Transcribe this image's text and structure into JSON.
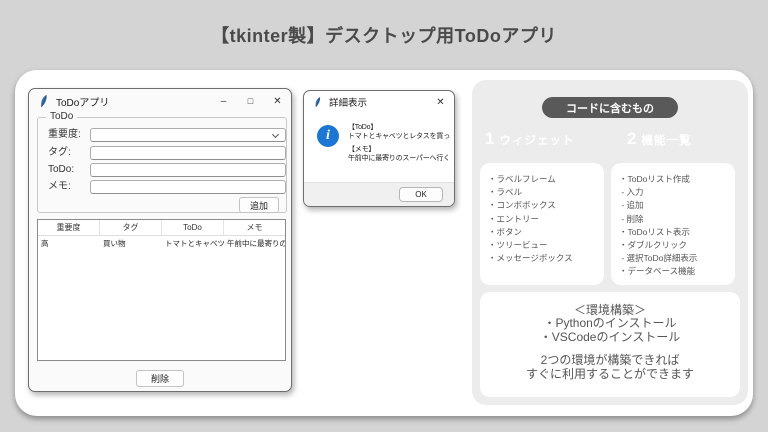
{
  "slide": {
    "title": "【tkinter製】デスクトップ用ToDoアプリ"
  },
  "todo_window": {
    "title": "ToDoアプリ",
    "controls": {
      "minimize": "–",
      "maximize": "□",
      "close": "✕"
    },
    "form": {
      "frame_label": "ToDo",
      "importance_label": "重要度:",
      "tag_label": "タグ:",
      "todo_label": "ToDo:",
      "memo_label": "メモ:",
      "importance_value": "",
      "add_button": "追加"
    },
    "tree": {
      "columns": [
        "重要度",
        "タグ",
        "ToDo",
        "メモ"
      ],
      "row": [
        "高",
        "買い物",
        "トマトとキャベツとレタスを買ってくる",
        "午前中に最寄りのスーパーへ行くこと"
      ]
    },
    "delete_button": "削除"
  },
  "detail_dialog": {
    "title": "詳細表示",
    "close": "✕",
    "message": {
      "todo_heading": "【ToDo】",
      "todo_text": "トマトとキャベツとレタスを買ってくる",
      "memo_heading": "【メモ】",
      "memo_text": "午前中に最寄りのスーパーへ行くこと"
    },
    "info_icon": "i",
    "ok_button": "OK"
  },
  "right_panel": {
    "pill_label": "コードに含むもの",
    "sections": [
      {
        "number": "1",
        "heading": "ウィジェット",
        "items": [
          "・ラベルフレーム",
          "・ラベル",
          "・コンボボックス",
          "・エントリー",
          "・ボタン",
          "・ツリービュー",
          "・メッセージボックス"
        ]
      },
      {
        "number": "2",
        "heading": "機能一覧",
        "items": [
          "・ToDoリスト作成",
          " - 入力",
          " - 追加",
          " - 削除",
          "・ToDoリスト表示",
          "・ダブルクリック",
          " - 選択ToDo詳細表示",
          "・データベース機能"
        ]
      }
    ],
    "env_card": {
      "heading": "＜環境構築＞",
      "items": [
        "・Pythonのインストール",
        "・VSCodeのインストール"
      ],
      "note": [
        "2つの環境が構築できれば",
        "すぐに利用することができます"
      ]
    }
  },
  "colors": {
    "page_bg": "#d4d4d4",
    "panel_bg": "#ececec",
    "pill_bg": "#595959",
    "info_icon_blue": "#1e76d3"
  }
}
